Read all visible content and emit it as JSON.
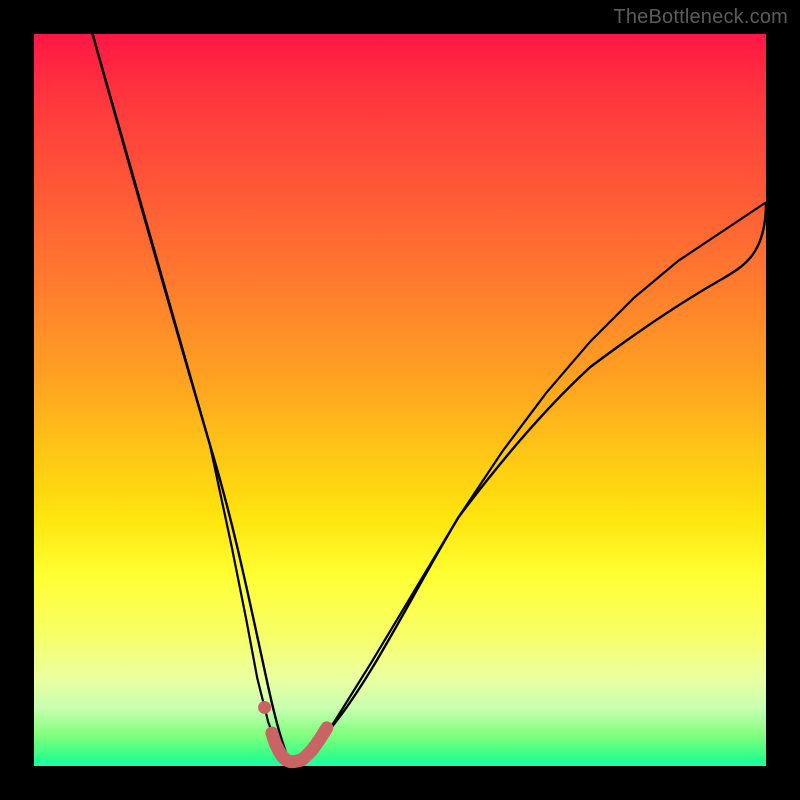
{
  "watermark": "TheBottleneck.com",
  "colors": {
    "curve": "#000000",
    "marker": "#c86464",
    "gradient_top": "#ff1744",
    "gradient_mid": "#ffe40d",
    "gradient_bottom": "#2aff8a",
    "background": "#000000"
  },
  "chart_data": {
    "type": "line",
    "title": "",
    "xlabel": "",
    "ylabel": "",
    "xlim": [
      0,
      100
    ],
    "ylim": [
      0,
      100
    ],
    "grid": false,
    "series": [
      {
        "name": "curve",
        "x": [
          8,
          12,
          16,
          20,
          24,
          27,
          29,
          30.5,
          32,
          33.5,
          35,
          36.5,
          38,
          41,
          46,
          52,
          58,
          64,
          70,
          76,
          82,
          88,
          94,
          100
        ],
        "y": [
          100,
          86,
          72,
          58,
          44,
          30,
          20,
          12,
          6,
          2,
          0.5,
          0.5,
          2,
          6,
          14,
          24,
          34,
          43,
          51,
          58,
          64,
          69,
          73,
          77
        ]
      },
      {
        "name": "highlight",
        "x": [
          31.5,
          32.5,
          33,
          33.5,
          34,
          34.5,
          35,
          35.5,
          36,
          36.5,
          37,
          38,
          39,
          40
        ],
        "y": [
          8,
          4.5,
          3,
          2,
          1.2,
          0.8,
          0.6,
          0.6,
          0.7,
          0.8,
          1.2,
          2.2,
          3.6,
          5.2
        ]
      }
    ],
    "annotations": []
  }
}
